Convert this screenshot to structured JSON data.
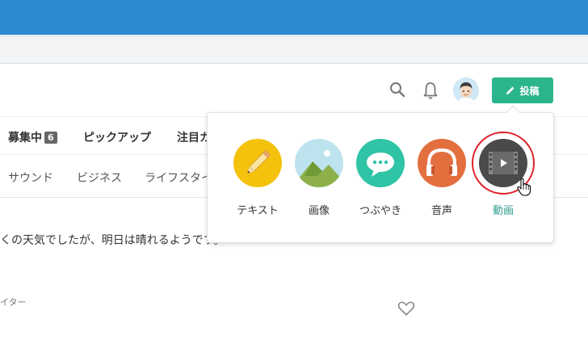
{
  "header": {
    "post_button_label": "投稿",
    "avatar_name": "avatar",
    "icons": [
      "search-icon",
      "bell-icon",
      "pencil-icon"
    ]
  },
  "nav": {
    "main_tabs": [
      {
        "label": "募集中",
        "badge": "6"
      },
      {
        "label": "ピックアップ"
      },
      {
        "label": "注目カ"
      }
    ],
    "sub_tabs": [
      "サウンド",
      "ビジネス",
      "ライフスタイ"
    ]
  },
  "content": {
    "body_text": "くの天気でしたが、明日は晴れるようです。",
    "creator_label": "イター"
  },
  "post_menu": {
    "items": [
      {
        "label": "テキスト",
        "icon": "pencil-icon",
        "color": "#f4c20d"
      },
      {
        "label": "画像",
        "icon": "image-icon",
        "color": "#bde3ee"
      },
      {
        "label": "つぶやき",
        "icon": "speech-bubble-icon",
        "color": "#2ec4a5"
      },
      {
        "label": "音声",
        "icon": "headphones-icon",
        "color": "#e36f3f"
      },
      {
        "label": "動画",
        "icon": "film-play-icon",
        "color": "#4a4a4a",
        "highlighted": true
      }
    ]
  },
  "colors": {
    "topbar": "#2a8bd0",
    "accent": "#2bb58c",
    "highlight_ring": "#e0202a"
  }
}
